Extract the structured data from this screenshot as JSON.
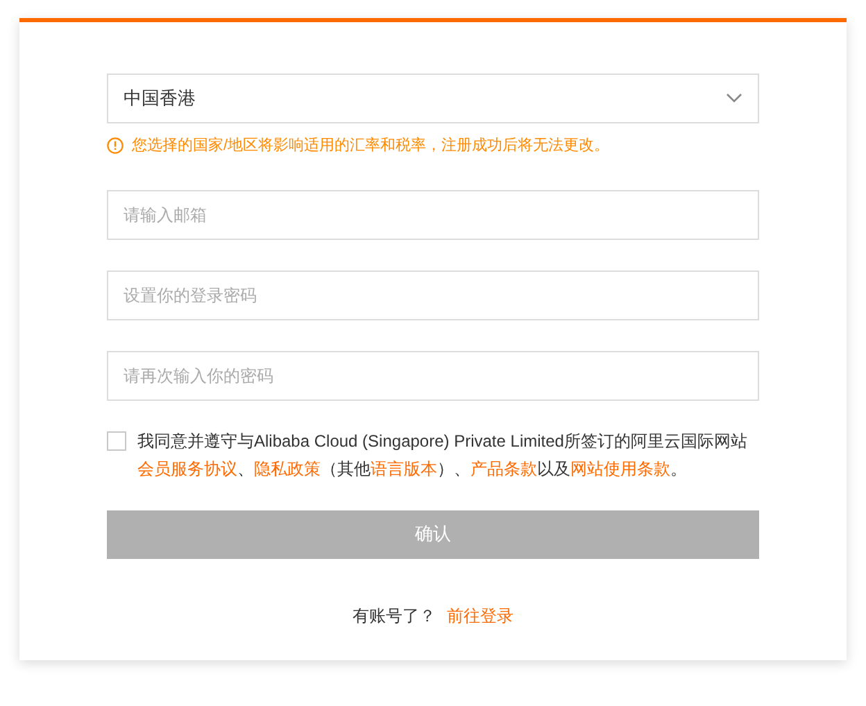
{
  "region_select": {
    "value": "中国香港"
  },
  "region_hint": "您选择的国家/地区将影响适用的汇率和税率，注册成功后将无法更改。",
  "fields": [
    {
      "placeholder": "请输入邮箱"
    },
    {
      "placeholder": "设置你的登录密码"
    },
    {
      "placeholder": "请再次输入你的密码"
    }
  ],
  "agreement": {
    "checked": false,
    "segments": [
      {
        "kind": "plain",
        "text": "我同意并遵守与Alibaba Cloud (Singapore) Private Limited所签订的阿里云国际网站"
      },
      {
        "kind": "link",
        "text": "会员服务协议"
      },
      {
        "kind": "plain",
        "text": "、"
      },
      {
        "kind": "link",
        "text": "隐私政策"
      },
      {
        "kind": "plain",
        "text": "（其他"
      },
      {
        "kind": "link",
        "text": "语言版本"
      },
      {
        "kind": "plain",
        "text": "）、"
      },
      {
        "kind": "link",
        "text": "产品条款"
      },
      {
        "kind": "plain",
        "text": "以及"
      },
      {
        "kind": "link",
        "text": "网站使用条款"
      },
      {
        "kind": "plain",
        "text": "。"
      }
    ]
  },
  "confirm_button": {
    "label": "确认",
    "disabled": true
  },
  "login_prompt": {
    "text": "有账号了？",
    "link": "前往登录"
  }
}
